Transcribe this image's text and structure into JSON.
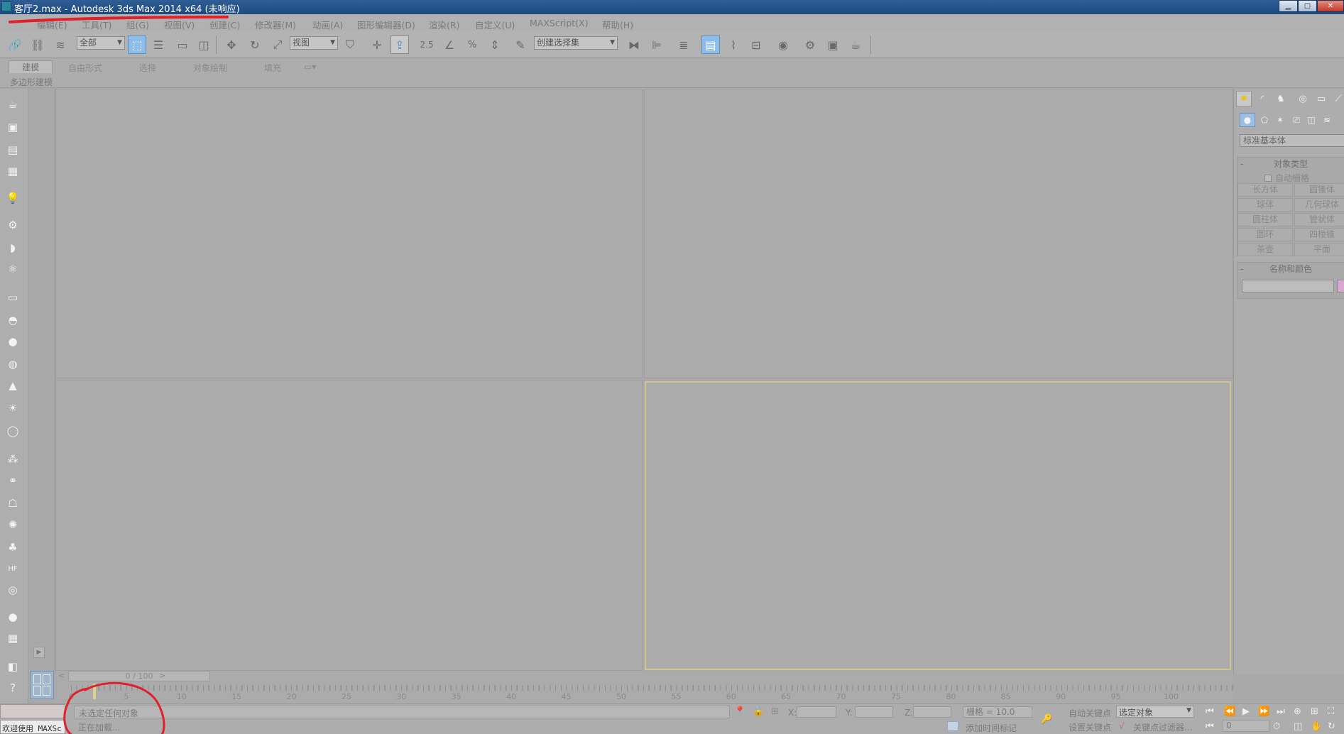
{
  "window": {
    "title": "客厅2.max - Autodesk 3ds Max  2014 x64   (未响应)",
    "minimize": "▁",
    "maximize": "▢",
    "close": "✕"
  },
  "menu": {
    "items": [
      "编辑(E)",
      "工具(T)",
      "组(G)",
      "视图(V)",
      "创建(C)",
      "修改器(M)",
      "动画(A)",
      "图形编辑器(D)",
      "渲染(R)",
      "自定义(U)",
      "MAXScript(X)",
      "帮助(H)"
    ]
  },
  "toolbar": {
    "selection_filter": "全部",
    "reference_coord": "视图",
    "snap_angle": "2.5",
    "named_selection_placeholder": "创建选择集"
  },
  "ribbon": {
    "tabs": [
      "建模",
      "自由形式",
      "选择",
      "对象绘制",
      "填充"
    ],
    "active_tab": "建模",
    "subpanel": "多边形建模"
  },
  "command_panel": {
    "category": "标准基本体",
    "object_type": {
      "title": "对象类型",
      "autogrid": "自动栅格",
      "buttons": [
        "长方体",
        "圆锥体",
        "球体",
        "几何球体",
        "圆柱体",
        "管状体",
        "圆环",
        "四棱锥",
        "茶壶",
        "平面"
      ]
    },
    "name_color": {
      "title": "名称和颜色",
      "name_value": "",
      "swatch_color": "#d9a6cf"
    },
    "collapse": "-"
  },
  "timeline": {
    "slider_label": "0 / 100",
    "prev": "<",
    "next": ">",
    "ticks": [
      "0",
      "5",
      "10",
      "15",
      "20",
      "25",
      "30",
      "35",
      "40",
      "45",
      "50",
      "55",
      "60",
      "65",
      "70",
      "75",
      "80",
      "85",
      "90",
      "95",
      "100"
    ]
  },
  "status": {
    "maxscript_label": "欢迎使用 MAXSc",
    "selection_info": "未选定任何对象",
    "prompt": "正在加载...",
    "x_label": "X:",
    "y_label": "Y:",
    "z_label": "Z:",
    "grid": "栅格 = 10.0",
    "add_time_tag": "添加时间标记",
    "auto_key": "自动关键点",
    "set_key": "设置关键点",
    "key_mode": "选定对象",
    "key_filters": "关键点过滤器...",
    "frame": "0"
  },
  "colors": {
    "titlebar": "#1d4a80",
    "viewport": "#ababab",
    "active_viewport_border": "#d4c48d",
    "annotation": "#e0202a"
  }
}
